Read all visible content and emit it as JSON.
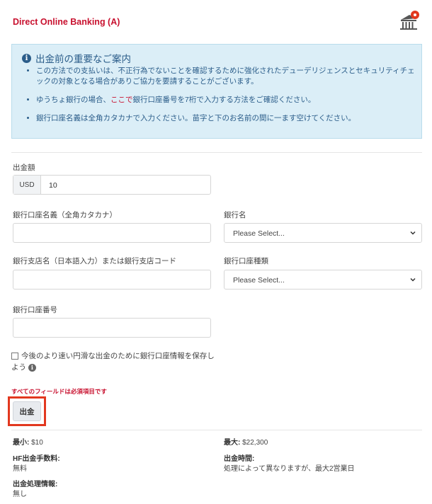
{
  "header": {
    "title": "Direct Online Banking (A)",
    "icon": "bank-icon"
  },
  "notice": {
    "heading": "出金前の重要なご案内",
    "items": [
      "この方法での支払いは、不正行為でないことを確認するために強化されたデューデリジェンスとセキュリティチェックの対象となる場合がありご協力を要請することがございます。",
      "銀行口座名義は全角カタカナで入力ください。苗字と下のお名前の間に一ます空けてください。"
    ],
    "item2_before": "ゆうちょ銀行の場合、",
    "item2_link": "ここで",
    "item2_after": "銀行口座番号を7桁で入力する方法をご確認ください。"
  },
  "form": {
    "amount_label": "出金額",
    "currency": "USD",
    "amount_value": "10",
    "account_name_label": "銀行口座名義（全角カタカナ）",
    "bank_name_label": "銀行名",
    "bank_name_value": "Please Select...",
    "branch_label": "銀行支店名（日本語入力）または銀行支店コード",
    "account_type_label": "銀行口座種類",
    "account_type_value": "Please Select...",
    "account_number_label": "銀行口座番号",
    "save_checkbox_label": "今後のより速い円滑な出金のために銀行口座情報を保存しよう",
    "required_note": "すべてのフィールドは必須項目です",
    "submit_label": "出金"
  },
  "limits": {
    "min_label": "最小:",
    "min_value": "$10",
    "max_label": "最大:",
    "max_value": "$22,300",
    "fee_label": "HF出金手数料:",
    "fee_value": "無料",
    "time_label": "出金時間:",
    "time_value": "処理によって異なりますが、最大2営業日",
    "processing_label": "出金処理情報:",
    "processing_value": "無し"
  },
  "colors": {
    "accent": "#c8102e",
    "notice_bg": "#dbeef7",
    "highlight": "#e2381f"
  }
}
